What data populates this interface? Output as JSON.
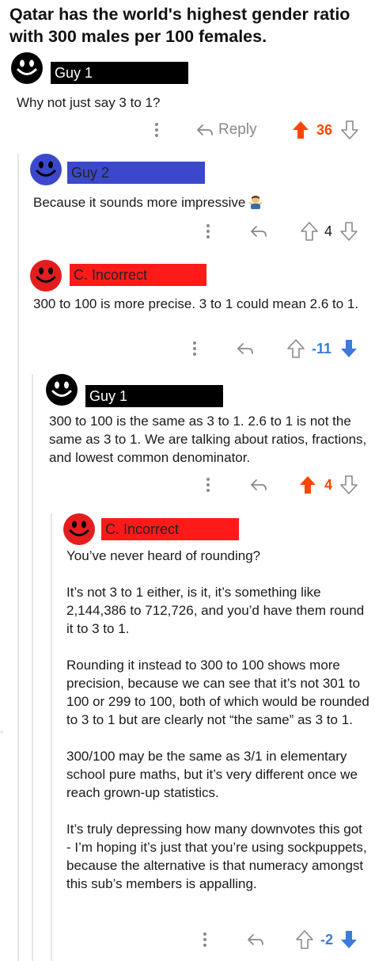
{
  "post": {
    "title": "Qatar has the world's highest gender ratio with 300 males per 100 females."
  },
  "colors": {
    "upvote_active": "#ff4500",
    "downvote_active": "#3c7adb",
    "neutral_icon": "#878a8c",
    "guy_face": "#000000",
    "guy2_face": "#3b48cc",
    "incorrect_face": "#e41e1e"
  },
  "comments": [
    {
      "author": "Guy 1",
      "avatar": "black-smiley-icon",
      "paragraphs": [
        "Why not just say 3 to 1?"
      ],
      "reply_label": "Reply",
      "score": "36",
      "vote": "up"
    },
    {
      "author": "Guy 2",
      "avatar": "blue-smiley-icon",
      "paragraphs": [
        "Because it sounds more impressive"
      ],
      "emoji": "shrug-emoji-icon",
      "score": "4",
      "vote": "none"
    },
    {
      "author": "C. Incorrect",
      "avatar": "red-smiley-icon",
      "paragraphs": [
        "300 to 100 is more precise. 3 to 1 could mean 2.6 to 1."
      ],
      "score": "-11",
      "vote": "down"
    },
    {
      "author": "Guy 1",
      "avatar": "black-smiley-icon",
      "paragraphs": [
        "300 to 100 is the same as 3 to 1. 2.6 to 1 is not the same as 3 to 1. We are talking about ratios, fractions, and lowest common denominator."
      ],
      "score": "4",
      "vote": "up"
    },
    {
      "author": "C. Incorrect",
      "avatar": "red-smiley-icon",
      "paragraphs": [
        "You’ve never heard of rounding?",
        "It’s not 3 to 1 either, is it, it’s something like 2,144,386 to 712,726, and you’d have them round it to 3 to 1.",
        "Rounding it instead to 300 to 100 shows more precision, because we can see that it’s not 301 to 100 or 299 to 100, both of which would be rounded to 3 to 1 but are clearly not “the same” as 3 to 1.",
        "300/100 may be the same as 3/1 in elementary school pure maths, but it’s very different once we reach grown-up statistics.",
        "It’s truly depressing how many downvotes this got - I’m hoping it’s just that you’re using sockpuppets, because the alternative is that numeracy amongst this sub’s members is appalling."
      ],
      "score": "-2",
      "vote": "down"
    }
  ]
}
